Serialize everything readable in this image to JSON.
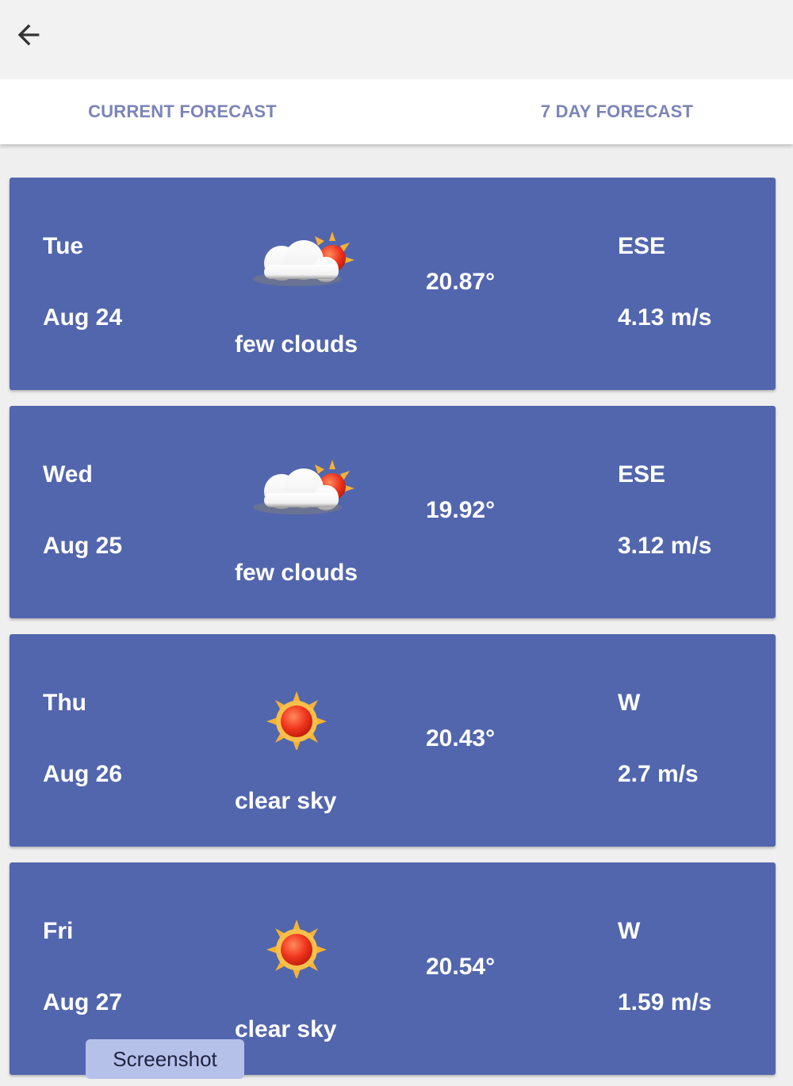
{
  "tabs": [
    {
      "label": "CURRENT FORECAST"
    },
    {
      "label": "7 DAY FORECAST"
    }
  ],
  "forecast": [
    {
      "day": "Tue",
      "date": "Aug 24",
      "description": "few clouds",
      "icon": "few-clouds-icon",
      "temperature": "20.87°",
      "wind_direction": "ESE",
      "wind_speed": "4.13 m/s"
    },
    {
      "day": "Wed",
      "date": "Aug 25",
      "description": "few clouds",
      "icon": "few-clouds-icon",
      "temperature": "19.92°",
      "wind_direction": "ESE",
      "wind_speed": "3.12 m/s"
    },
    {
      "day": "Thu",
      "date": "Aug 26",
      "description": "clear sky",
      "icon": "clear-sky-icon",
      "temperature": "20.43°",
      "wind_direction": "W",
      "wind_speed": "2.7 m/s"
    },
    {
      "day": "Fri",
      "date": "Aug 27",
      "description": "clear sky",
      "icon": "clear-sky-icon",
      "temperature": "20.54°",
      "wind_direction": "W",
      "wind_speed": "1.59 m/s"
    }
  ],
  "tooltip": {
    "label": "Screenshot"
  },
  "colors": {
    "card_background": "#5266ad",
    "tab_text": "#7b84b8",
    "app_bar": "#f2f2f2"
  }
}
